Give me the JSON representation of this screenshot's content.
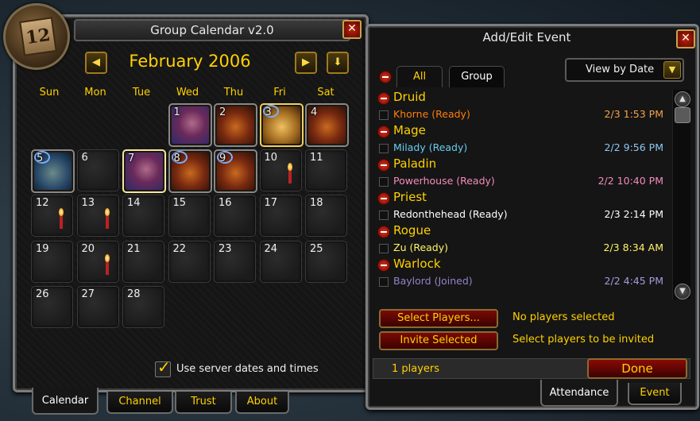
{
  "calendar": {
    "title": "Group Calendar v2.0",
    "month_icon_day": "12",
    "month_label": "February 2006",
    "prev_icon": "left-arrow",
    "next_icon": "right-arrow",
    "today_icon": "down-arrow",
    "close_label": "✕",
    "weekdays": [
      "Sun",
      "Mon",
      "Tue",
      "Wed",
      "Thu",
      "Fri",
      "Sat"
    ],
    "days": [
      {
        "n": "1",
        "event": "gnome"
      },
      {
        "n": "2",
        "event": "orc"
      },
      {
        "n": "3",
        "event": "tauren",
        "badge": true,
        "highlight": true
      },
      {
        "n": "4",
        "event": "orc"
      },
      {
        "n": "5",
        "event": "undead",
        "badge": true
      },
      {
        "n": "6"
      },
      {
        "n": "7",
        "event": "gnome",
        "today": true
      },
      {
        "n": "8",
        "event": "orc",
        "badge": true
      },
      {
        "n": "9",
        "event": "orc",
        "badge": true
      },
      {
        "n": "10",
        "candle": true
      },
      {
        "n": "11"
      },
      {
        "n": "12",
        "candle": true
      },
      {
        "n": "13",
        "candle": true
      },
      {
        "n": "14"
      },
      {
        "n": "15"
      },
      {
        "n": "16"
      },
      {
        "n": "17"
      },
      {
        "n": "18"
      },
      {
        "n": "19"
      },
      {
        "n": "20",
        "candle": true
      },
      {
        "n": "21"
      },
      {
        "n": "22"
      },
      {
        "n": "23"
      },
      {
        "n": "24"
      },
      {
        "n": "25"
      },
      {
        "n": "26"
      },
      {
        "n": "27"
      },
      {
        "n": "28"
      }
    ],
    "server_time_label": "Use server dates and times",
    "server_time_checked": true,
    "tabs": [
      "Calendar",
      "Channel",
      "Trust",
      "About"
    ],
    "active_tab": "Calendar"
  },
  "event_editor": {
    "title": "Add/Edit Event",
    "close_label": "✕",
    "filter_tabs": [
      "All",
      "Group"
    ],
    "active_filter": "Group",
    "view_by": "View by Date",
    "groups": [
      {
        "class": "Druid",
        "color": "#ff7d0a",
        "players": [
          {
            "name": "Khorne (Ready)",
            "time": "2/3 1:53 PM"
          }
        ]
      },
      {
        "class": "Mage",
        "color": "#69ccf0",
        "players": [
          {
            "name": "Milady (Ready)",
            "time": "2/2 9:56 PM"
          }
        ]
      },
      {
        "class": "Paladin",
        "color": "#f58cba",
        "players": [
          {
            "name": "Powerhouse (Ready)",
            "time": "2/2 10:40 PM"
          }
        ]
      },
      {
        "class": "Priest",
        "color": "#ffffff",
        "players": [
          {
            "name": "Redonthehead (Ready)",
            "time": "2/3 2:14 PM"
          }
        ]
      },
      {
        "class": "Rogue",
        "color": "#fff569",
        "players": [
          {
            "name": "Zu (Ready)",
            "time": "2/3 8:34 AM"
          }
        ]
      },
      {
        "class": "Warlock",
        "color": "#9482c9",
        "players": [
          {
            "name": "Baylord (Joined)",
            "time": "2/2 4:45 PM"
          }
        ]
      }
    ],
    "select_players_label": "Select Players...",
    "select_status": "No players selected",
    "invite_label": "Invite Selected",
    "invite_status": "Select players to be invited",
    "player_count": "1 players",
    "done_label": "Done",
    "tabs": [
      "Attendance",
      "Event"
    ],
    "active_tab": "Attendance"
  },
  "colors": {
    "gold": "#ffd100",
    "class_header": "#ffd100"
  }
}
